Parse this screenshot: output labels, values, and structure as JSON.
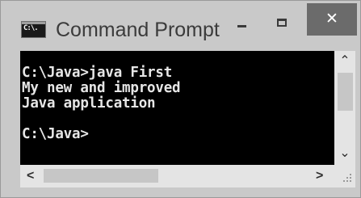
{
  "window": {
    "title": "Command Prompt",
    "icon_text": "C:\\.",
    "icon": "cmd-icon",
    "controls": {
      "minimize": "minimize-icon",
      "maximize": "maximize-icon",
      "close_glyph": "✕"
    }
  },
  "console": {
    "lines": [
      "C:\\Java>java First",
      "My new and improved",
      "Java application",
      "",
      "C:\\Java>"
    ]
  },
  "scrollbars": {
    "vertical": {
      "up_glyph": "⌃",
      "down_glyph": "⌄"
    },
    "horizontal": {
      "left_glyph": "<",
      "right_glyph": ">"
    }
  },
  "colors": {
    "titlebar": "#c9c9c9",
    "console_bg": "#000000",
    "console_text": "#e6e6e6",
    "close_button": "#6b6b6b"
  }
}
